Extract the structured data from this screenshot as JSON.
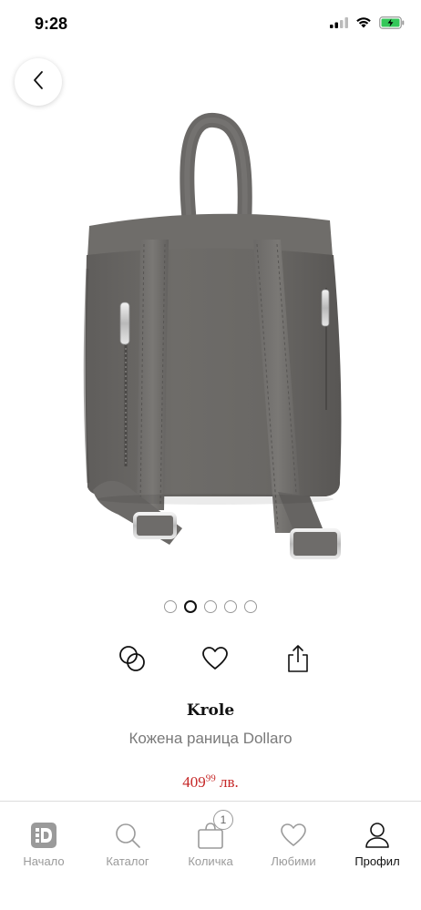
{
  "status_bar": {
    "time": "9:28",
    "icons": [
      "signal-icon",
      "wifi-icon",
      "battery-charging-icon"
    ]
  },
  "navigation": {
    "back_icon": "chevron-left-icon"
  },
  "carousel": {
    "total_dots": 5,
    "active_index": 1
  },
  "actions": [
    {
      "name": "compare-button",
      "icon": "compare-circles-icon"
    },
    {
      "name": "favorite-button",
      "icon": "heart-icon"
    },
    {
      "name": "share-button",
      "icon": "share-icon"
    }
  ],
  "product": {
    "brand": "Krole",
    "name": "Кожена раница Dollaro",
    "price_main": "409",
    "price_cents": "99",
    "currency": " лв.",
    "price_color": "#c62828"
  },
  "tab_bar": {
    "items": [
      {
        "label": "Начало",
        "icon": "home-logo-icon"
      },
      {
        "label": "Каталог",
        "icon": "search-icon"
      },
      {
        "label": "Количка",
        "icon": "bag-icon",
        "badge": "1"
      },
      {
        "label": "Любими",
        "icon": "heart-icon"
      },
      {
        "label": "Профил",
        "icon": "profile-icon",
        "active": true
      }
    ]
  }
}
